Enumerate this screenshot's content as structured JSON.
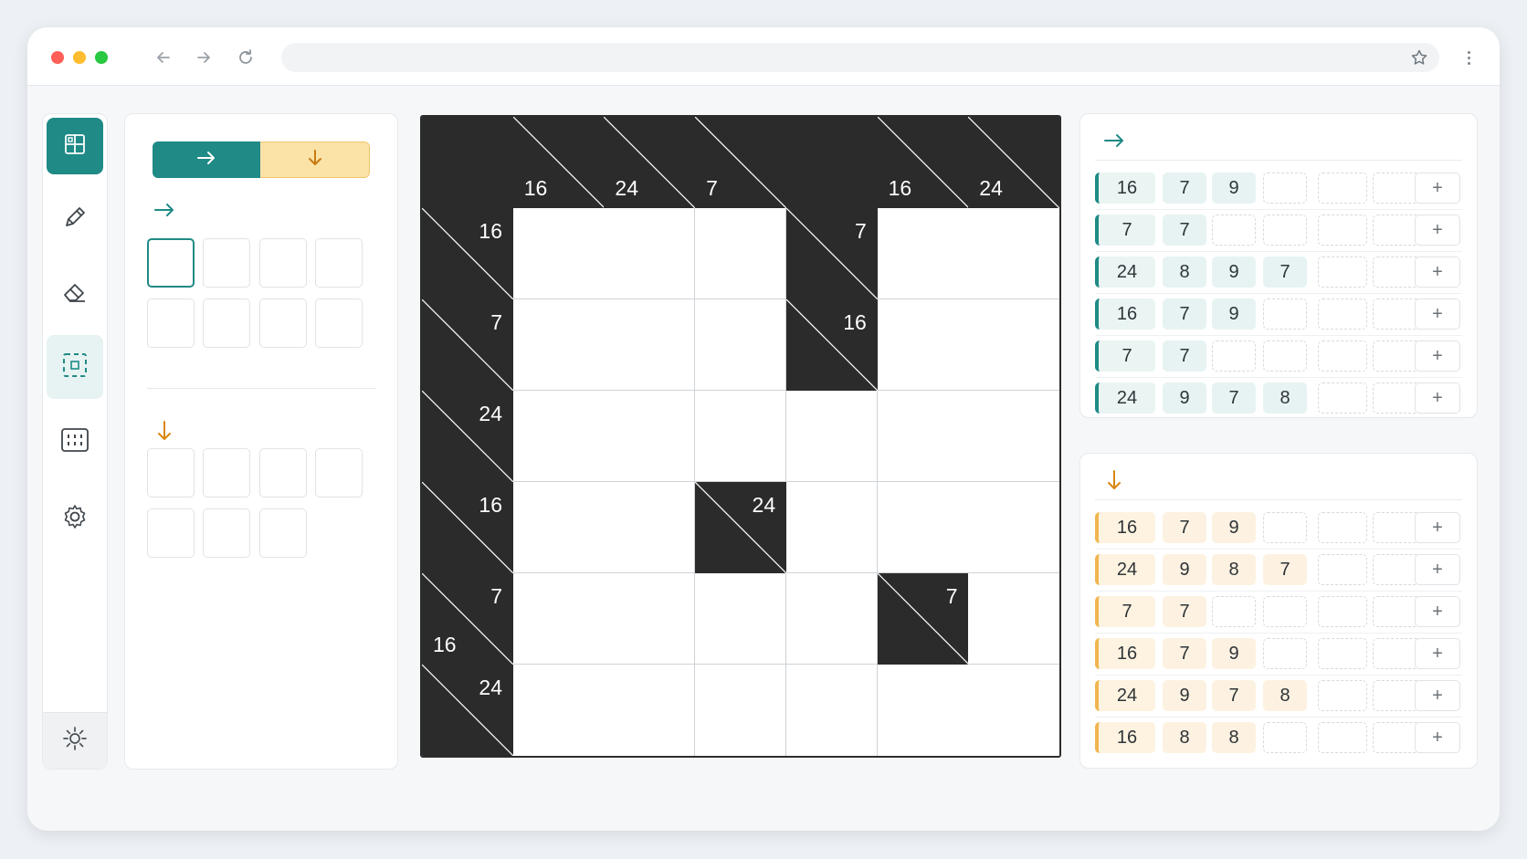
{
  "colors": {
    "accent": "#1f8a86",
    "across_accent": "#1f8a86",
    "down_accent": "#e08a12",
    "board_black": "#2b2b2b"
  },
  "toolbar": {
    "traffic_lights": [
      "#ff5f57",
      "#febc2e",
      "#28c840"
    ],
    "icons": [
      "back-arrow-icon",
      "forward-arrow-icon",
      "reload-icon",
      "star-icon",
      "more-vert-icon"
    ],
    "url": ""
  },
  "sidebar": {
    "items": [
      {
        "name": "layout-grid-icon",
        "state": "active"
      },
      {
        "name": "pencil-icon",
        "state": ""
      },
      {
        "name": "eraser-icon",
        "state": ""
      },
      {
        "name": "selection-icon",
        "state": "highlighted"
      },
      {
        "name": "keypad-icon",
        "state": ""
      },
      {
        "name": "settings-gear-icon",
        "state": ""
      }
    ],
    "footer_icon": "sun-icon"
  },
  "left_panel": {
    "toggle": {
      "across_icon": "arrow-right-icon",
      "down_icon": "arrow-down-icon",
      "selected": "across"
    },
    "across": {
      "icon": "arrow-right-icon",
      "slot_count": 8,
      "selected_slot": 0
    },
    "down": {
      "icon": "arrow-down-icon",
      "slot_count": 7
    }
  },
  "board": {
    "rows": 7,
    "cols": 7,
    "cells": [
      [
        {
          "t": "b"
        },
        {
          "t": "b",
          "down": "16"
        },
        {
          "t": "b",
          "down": "24"
        },
        {
          "t": "b",
          "down": "7"
        },
        {
          "t": "b"
        },
        {
          "t": "b",
          "down": "16"
        },
        {
          "t": "b",
          "down": "24"
        }
      ],
      [
        {
          "t": "b",
          "across": "16"
        },
        {
          "t": "w"
        },
        {
          "t": "w"
        },
        {
          "t": "w"
        },
        {
          "t": "b",
          "across": "7"
        },
        {
          "t": "w"
        },
        {
          "t": "w"
        }
      ],
      [
        {
          "t": "b",
          "across": "7"
        },
        {
          "t": "w"
        },
        {
          "t": "w"
        },
        {
          "t": "w"
        },
        {
          "t": "b",
          "across": "16"
        },
        {
          "t": "w"
        },
        {
          "t": "w"
        }
      ],
      [
        {
          "t": "b",
          "across": "24"
        },
        {
          "t": "w"
        },
        {
          "t": "w"
        },
        {
          "t": "w"
        },
        {
          "t": "w"
        },
        {
          "t": "w"
        },
        {
          "t": "w"
        }
      ],
      [
        {
          "t": "b",
          "across": "16"
        },
        {
          "t": "w"
        },
        {
          "t": "w"
        },
        {
          "t": "b",
          "across": "24"
        },
        {
          "t": "w"
        },
        {
          "t": "w"
        },
        {
          "t": "w"
        }
      ],
      [
        {
          "t": "b",
          "across": "7",
          "down": "16"
        },
        {
          "t": "w"
        },
        {
          "t": "w"
        },
        {
          "t": "w"
        },
        {
          "t": "w"
        },
        {
          "t": "b",
          "across": "7"
        },
        {
          "t": "w"
        }
      ],
      [
        {
          "t": "b",
          "across": "24"
        },
        {
          "t": "w"
        },
        {
          "t": "w"
        },
        {
          "t": "w"
        },
        {
          "t": "w"
        },
        {
          "t": "w"
        },
        {
          "t": "w"
        }
      ]
    ]
  },
  "across_panel": {
    "icon": "arrow-right-icon",
    "rows": [
      {
        "sum": "16",
        "values": [
          "7",
          "9"
        ]
      },
      {
        "sum": "7",
        "values": [
          "7"
        ]
      },
      {
        "sum": "24",
        "values": [
          "8",
          "9",
          "7"
        ]
      },
      {
        "sum": "16",
        "values": [
          "7",
          "9"
        ]
      },
      {
        "sum": "7",
        "values": [
          "7"
        ]
      },
      {
        "sum": "24",
        "values": [
          "9",
          "7",
          "8"
        ]
      }
    ],
    "add_label": "+"
  },
  "down_panel": {
    "icon": "arrow-down-icon",
    "rows": [
      {
        "sum": "16",
        "values": [
          "7",
          "9"
        ]
      },
      {
        "sum": "24",
        "values": [
          "9",
          "8",
          "7"
        ]
      },
      {
        "sum": "7",
        "values": [
          "7"
        ]
      },
      {
        "sum": "16",
        "values": [
          "7",
          "9"
        ]
      },
      {
        "sum": "24",
        "values": [
          "9",
          "7",
          "8"
        ]
      },
      {
        "sum": "16",
        "values": [
          "8",
          "8"
        ]
      }
    ],
    "add_label": "+"
  }
}
